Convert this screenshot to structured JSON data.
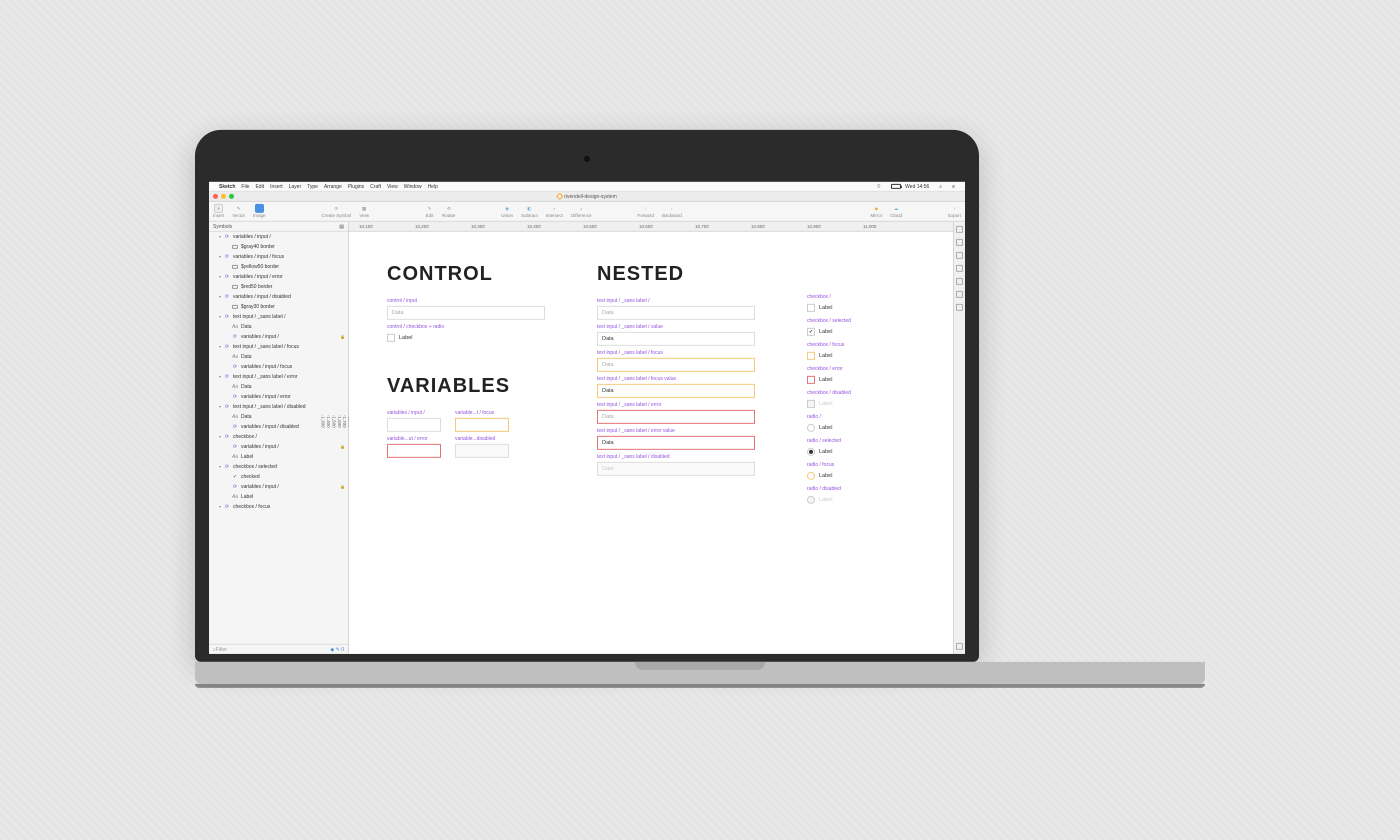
{
  "menubar": {
    "app": "Sketch",
    "items": [
      "File",
      "Edit",
      "Insert",
      "Layer",
      "Type",
      "Arrange",
      "Plugins",
      "Craft",
      "View",
      "Window",
      "Help"
    ],
    "time": "Wed 14:56"
  },
  "window": {
    "title": "rivendell-design-system"
  },
  "toolbar": {
    "insert": "Insert",
    "vector": "Vector",
    "image": "Image",
    "createSymbol": "Create Symbol",
    "view": "View",
    "edit": "Edit",
    "rotate": "Rotate",
    "union": "Union",
    "subtract": "Subtract",
    "intersect": "Intersect",
    "difference": "Difference",
    "forward": "Forward",
    "backward": "Backward",
    "mirror": "Mirror",
    "cloud": "Cloud",
    "export": "Export"
  },
  "sidebar": {
    "pages": "Symbols",
    "filter": "Filter",
    "layers": [
      {
        "d": 1,
        "t": "sym",
        "n": "variables / input /"
      },
      {
        "d": 2,
        "t": "rect",
        "n": "$gray40 border"
      },
      {
        "d": 1,
        "t": "sym",
        "n": "variables / input / focus"
      },
      {
        "d": 2,
        "t": "rect",
        "n": "$yellow50 border"
      },
      {
        "d": 1,
        "t": "sym",
        "n": "variables / input / error"
      },
      {
        "d": 2,
        "t": "rect",
        "n": "$red50 border"
      },
      {
        "d": 1,
        "t": "sym",
        "n": "variables / input / disabled"
      },
      {
        "d": 2,
        "t": "rect",
        "n": "$gray30 border"
      },
      {
        "d": 1,
        "t": "sym",
        "n": "text input / _sans label /"
      },
      {
        "d": 2,
        "t": "txt",
        "n": "Data"
      },
      {
        "d": 2,
        "t": "sym",
        "n": "variables / input /",
        "lock": true
      },
      {
        "d": 1,
        "t": "sym",
        "n": "text input / _sans label / focus"
      },
      {
        "d": 2,
        "t": "txt",
        "n": "Data"
      },
      {
        "d": 2,
        "t": "sym",
        "n": "variables / input / focus"
      },
      {
        "d": 1,
        "t": "sym",
        "n": "text input / _sans label / error"
      },
      {
        "d": 2,
        "t": "txt",
        "n": "Data"
      },
      {
        "d": 2,
        "t": "sym",
        "n": "variables / input / error"
      },
      {
        "d": 1,
        "t": "sym",
        "n": "text input / _sans label / disabled"
      },
      {
        "d": 2,
        "t": "txt",
        "n": "Data"
      },
      {
        "d": 2,
        "t": "sym",
        "n": "variables / input / disabled"
      },
      {
        "d": 1,
        "t": "sym",
        "n": "checkbox /"
      },
      {
        "d": 2,
        "t": "sym",
        "n": "variables / input /",
        "lock": true
      },
      {
        "d": 2,
        "t": "txt",
        "n": "Label"
      },
      {
        "d": 1,
        "t": "sym",
        "n": "checkbox / selected"
      },
      {
        "d": 2,
        "t": "chk",
        "n": "checked"
      },
      {
        "d": 2,
        "t": "sym",
        "n": "variables / input /",
        "lock": true
      },
      {
        "d": 2,
        "t": "txt",
        "n": "Label"
      },
      {
        "d": 1,
        "t": "sym",
        "n": "checkbox / focus"
      }
    ]
  },
  "ruler": {
    "h": [
      "10,100",
      "10,200",
      "10,300",
      "10,400",
      "10,500",
      "10,600",
      "10,700",
      "10,800",
      "10,900",
      "11,000"
    ],
    "v": [
      "-1,900",
      "-1,800",
      "-1,700",
      "-1,600",
      "-1,500",
      "-1,400",
      "-1,300"
    ]
  },
  "canvas": {
    "control": {
      "heading": "CONTROL",
      "input_label": "control / input",
      "input_ph": "Data",
      "cb_label": "control / checkbox + radio",
      "cb_text": "Label"
    },
    "variables": {
      "heading": "VARIABLES",
      "v1": "variables / input /",
      "v2": "variable...t / focus",
      "v3": "variable...ut / error",
      "v4": "variable...disabled"
    },
    "nested": {
      "heading": "NESTED",
      "items": [
        {
          "l": "text input / _sans label /",
          "v": "Data",
          "cls": ""
        },
        {
          "l": "text input / _sans label / value",
          "v": "Data",
          "cls": "val"
        },
        {
          "l": "text input / _sans label / focus",
          "v": "Data",
          "cls": "focus"
        },
        {
          "l": "text input / _sans label / focus value",
          "v": "Data",
          "cls": "focus val"
        },
        {
          "l": "text input / _sans label / error",
          "v": "Data",
          "cls": "err"
        },
        {
          "l": "text input / _sans label / error value",
          "v": "Data",
          "cls": "err val"
        },
        {
          "l": "text input / _sans label / disabled",
          "v": "Data",
          "cls": "dis"
        }
      ]
    },
    "checks": [
      {
        "l": "checkbox /",
        "t": "Label",
        "cls": "chk"
      },
      {
        "l": "checkbox / selected",
        "t": "Label",
        "cls": "chk sel"
      },
      {
        "l": "checkbox / focus",
        "t": "Label",
        "cls": "chk foc"
      },
      {
        "l": "checkbox / error",
        "t": "Label",
        "cls": "chk error"
      },
      {
        "l": "checkbox / disabled",
        "t": "Label",
        "cls": "chk disb"
      },
      {
        "l": "radio /",
        "t": "Label",
        "cls": "chk rd"
      },
      {
        "l": "radio / selected",
        "t": "Label",
        "cls": "chk rd sel"
      },
      {
        "l": "radio / focus",
        "t": "Label",
        "cls": "chk rd foc"
      },
      {
        "l": "radio / disabled",
        "t": "Label",
        "cls": "chk rd disb"
      }
    ]
  }
}
